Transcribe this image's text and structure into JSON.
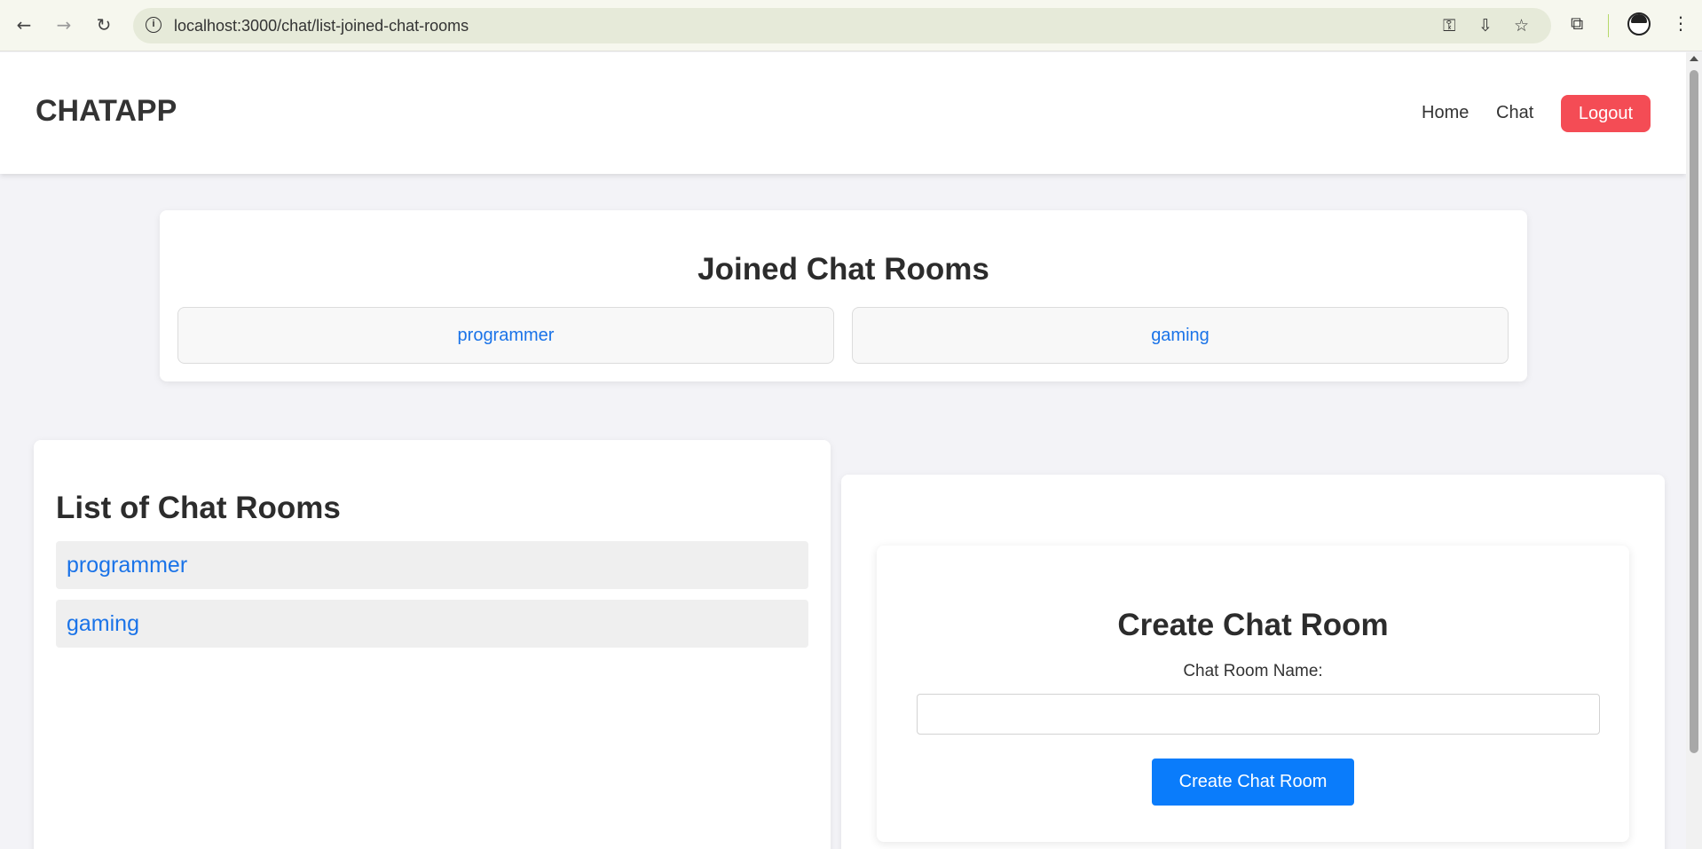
{
  "browser": {
    "url": "localhost:3000/chat/list-joined-chat-rooms",
    "back_icon": "←",
    "forward_icon": "→",
    "reload_icon": "↻",
    "key_icon": "⚿",
    "install_icon": "⇩",
    "star_icon": "☆",
    "extensions_icon": "⧉",
    "menu_icon": "⋮"
  },
  "navbar": {
    "brand": "CHATAPP",
    "links": [
      "Home",
      "Chat"
    ],
    "logout_label": "Logout"
  },
  "joined": {
    "title": "Joined Chat Rooms",
    "rooms": [
      "programmer",
      "gaming"
    ]
  },
  "list": {
    "title": "List of Chat Rooms",
    "rooms": [
      "programmer",
      "gaming"
    ]
  },
  "create": {
    "title": "Create Chat Room",
    "label": "Chat Room Name:",
    "input_value": "",
    "button_label": "Create Chat Room"
  },
  "colors": {
    "accent_link": "#1a73e8",
    "logout": "#f44c55",
    "primary_button": "#0a7cfb"
  }
}
